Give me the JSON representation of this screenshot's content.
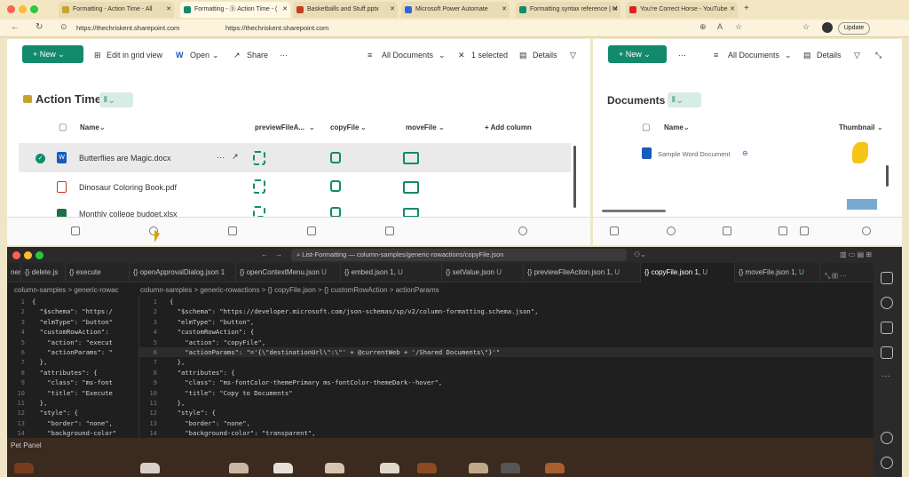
{
  "browser": {
    "tabs": [
      {
        "label": "Formatting - Action Time - All",
        "color": "#c8a231"
      },
      {
        "label": "Formatting - ⓑ Action Time - (",
        "color": "#138a6c",
        "active": true
      },
      {
        "label": "Basketballs and Stuff.pptx",
        "color": "#c43e1c"
      },
      {
        "label": "Microsoft Power Automate",
        "color": "#2f66d6"
      },
      {
        "label": "Formatting syntax reference | M",
        "color": "#138a6c"
      },
      {
        "label": "You're Correct Horse - YouTube",
        "color": "#e02020"
      }
    ],
    "new_tab": "+",
    "address_left": "https://thechriskent.sharepoint.com",
    "address_right": "https://thechriskent.sharepoint.com",
    "update_label": "Update"
  },
  "left_pane": {
    "toolbar": {
      "new": "+ New",
      "edit_grid": "Edit in grid view",
      "open": "Open",
      "share": "Share",
      "more": "···",
      "view": "All Documents",
      "selected": "1 selected",
      "details": "Details"
    },
    "list_title": "Action Time",
    "columns": [
      "Name",
      "previewFileA...",
      "copyFile",
      "moveFile",
      "+ Add column"
    ],
    "rows": [
      {
        "name": "Butterflies are Magic.docx",
        "selected": true
      },
      {
        "name": "Dinosaur Coloring Book.pdf"
      },
      {
        "name": "Monthly college budget.xlsx"
      }
    ]
  },
  "right_pane": {
    "toolbar": {
      "new": "+ New",
      "more": "···",
      "view": "All Documents",
      "details": "Details"
    },
    "list_title": "Documents",
    "columns": [
      "Name",
      "Thumbnail"
    ],
    "rows": [
      {
        "name": "Sample Word Document"
      }
    ]
  },
  "vscode": {
    "title": "List-Formatting — column-samples/generic-rowactions/copyFile.json",
    "nav_left": "←",
    "nav_right": "→",
    "tabs": [
      {
        "label": "ner",
        "u": ""
      },
      {
        "label": "{} delete.js",
        "u": ""
      },
      {
        "label": "{} execute",
        "u": ""
      },
      {
        "label": "{} openApprovalDialog.json 1",
        "u": ""
      },
      {
        "label": "{} openContextMenu.json",
        "u": "U"
      },
      {
        "label": "{} embed.json 1,",
        "u": "U"
      },
      {
        "label": "{} setValue.json",
        "u": "U"
      },
      {
        "label": "{} previewFileAction.json 1,",
        "u": "U"
      },
      {
        "label": "{} copyFile.json 1,",
        "u": "U"
      },
      {
        "label": "{} moveFile.json 1,",
        "u": "U"
      }
    ],
    "breadcrumb_left": "column-samples > generic-rowac",
    "breadcrumb_right": "column-samples > generic-rowactions > {} copyFile.json > {} customRowAction > actionParams",
    "line_numbers": [
      "1",
      "2",
      "3",
      "4",
      "5",
      "6",
      "7",
      "8",
      "9",
      "10",
      "11",
      "12",
      "13",
      "14"
    ],
    "left_code": [
      "{",
      "  \"$schema\": \"https:/",
      "  \"elmType\": \"button\"",
      "  \"customRowAction\":",
      "    \"action\": \"execut",
      "    \"actionParams\": \"",
      "  },",
      "  \"attributes\": {",
      "    \"class\": \"ms-font",
      "    \"title\": \"Execute",
      "  },",
      "  \"style\": {",
      "    \"border\": \"none\",",
      "    \"background-color\""
    ],
    "right_code": [
      "{",
      "  \"$schema\": \"https://developer.microsoft.com/json-schemas/sp/v2/column-formatting.schema.json\",",
      "  \"elmType\": \"button\",",
      "  \"customRowAction\": {",
      "    \"action\": \"copyFile\",",
      "    \"actionParams\": \"='{\\\"destinationUrl\\\":\\\"' + @currentWeb + '/Shared Documents\\\"}'\"",
      "  },",
      "  \"attributes\": {",
      "    \"class\": \"ms-fontColor-themePrimary ms-fontColor-themeDark--hover\",",
      "    \"title\": \"Copy to Documents\"",
      "  },",
      "  \"style\": {",
      "    \"border\": \"none\",",
      "    \"background-color\": \"transparent\","
    ],
    "pet_panel": "Pet Panel"
  }
}
